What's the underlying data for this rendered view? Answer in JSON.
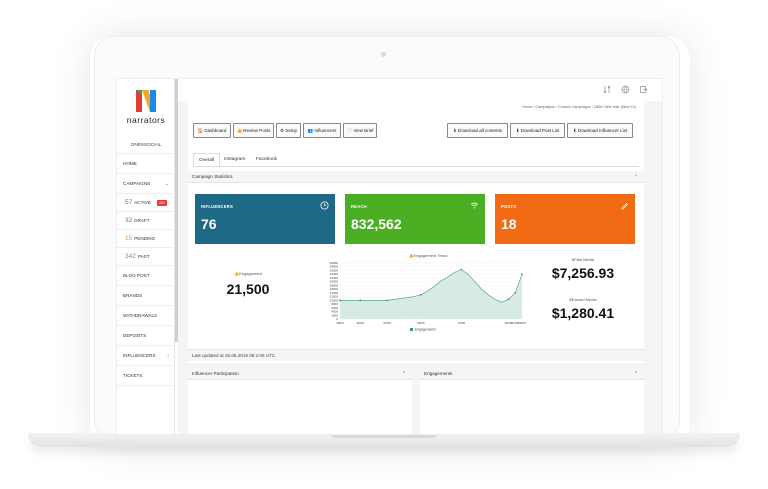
{
  "sidebar": {
    "brand": "narrators",
    "org": "ONE9SOCIAL",
    "items": [
      {
        "label": "HOME"
      },
      {
        "label": "CAMPAIGNS",
        "caret": "⌄"
      },
      {
        "count": "57",
        "label": "ACTIVE",
        "badge": "454",
        "color": "#2e9e44"
      },
      {
        "count": "32",
        "label": "DRAFT",
        "color": "#2196c9"
      },
      {
        "count": "15",
        "label": "PENDING",
        "color": "#f09020"
      },
      {
        "count": "342",
        "label": "PAST",
        "color": "#888888"
      },
      {
        "label": "BLOG POST"
      },
      {
        "label": "BRANDS"
      },
      {
        "label": "WITHDRAWALS"
      },
      {
        "label": "DEPOSITS"
      },
      {
        "label": "INFLUENCERS",
        "caret": "‹"
      },
      {
        "label": "TICKETS"
      }
    ]
  },
  "breadcrumb": "Home  /  Campaigns  /  Current Campaigns  /  1806 View Hair (New Yo)",
  "toolbar": {
    "dashboard": "Dashboard",
    "review_posts": "Review Posts",
    "setup": "Setup",
    "influencers": "Influencers",
    "view_brief": "View Brief",
    "download_all": "Download all contents",
    "download_post_list": "Download Post List",
    "download_influencer_list": "Download Influencer List"
  },
  "tabs": [
    "Overall",
    "Instagram",
    "Facebook"
  ],
  "stats_title": "Campaign Statistics",
  "cards": [
    {
      "label": "INFLUENCERS",
      "value": "76",
      "color": "#1e6985",
      "icon": "clock-icon"
    },
    {
      "label": "REACH",
      "value": "832,562",
      "color": "#4caf23",
      "icon": "wifi-icon"
    },
    {
      "label": "POSTS",
      "value": "18",
      "color": "#f26b14",
      "icon": "pencil-icon"
    }
  ],
  "engagement": {
    "label": "Engagement",
    "value": "21,500"
  },
  "paid_media": {
    "label": "Paid Media",
    "value": "$7,256.93"
  },
  "earned_media": {
    "label": "Earned Media",
    "value": "$1,280.41"
  },
  "chart_data": {
    "type": "area",
    "title": "Engagement Trend",
    "x": [
      "18/04",
      "",
      "",
      "25/04",
      "",
      "",
      "",
      "02/05",
      "",
      "",
      "",
      "",
      "09/05",
      "",
      "",
      "",
      "",
      "",
      "14/05",
      "",
      "",
      "",
      "",
      "",
      "",
      "20/05",
      "21/05",
      "25/05"
    ],
    "series": [
      {
        "name": "Engagements",
        "values": [
          10000,
          10000,
          10000,
          10000,
          10000,
          10000,
          10000,
          10000,
          10500,
          11000,
          11500,
          12000,
          13000,
          15000,
          17500,
          20500,
          22500,
          25000,
          26500,
          24000,
          20000,
          16000,
          13000,
          10500,
          9000,
          10500,
          14000,
          24000
        ]
      }
    ],
    "ylim": [
      0,
      30000
    ],
    "yticks": [
      0,
      2000,
      4000,
      6000,
      8000,
      10000,
      12000,
      14000,
      16000,
      18000,
      20000,
      22000,
      24000,
      26000,
      28000,
      30000
    ],
    "color": "#3c9a7a"
  },
  "last_updated": "Last updated at 25.05.2019 05:1:05 UTC",
  "bottom_panels": [
    "Influencer Participation",
    "Engagements"
  ]
}
